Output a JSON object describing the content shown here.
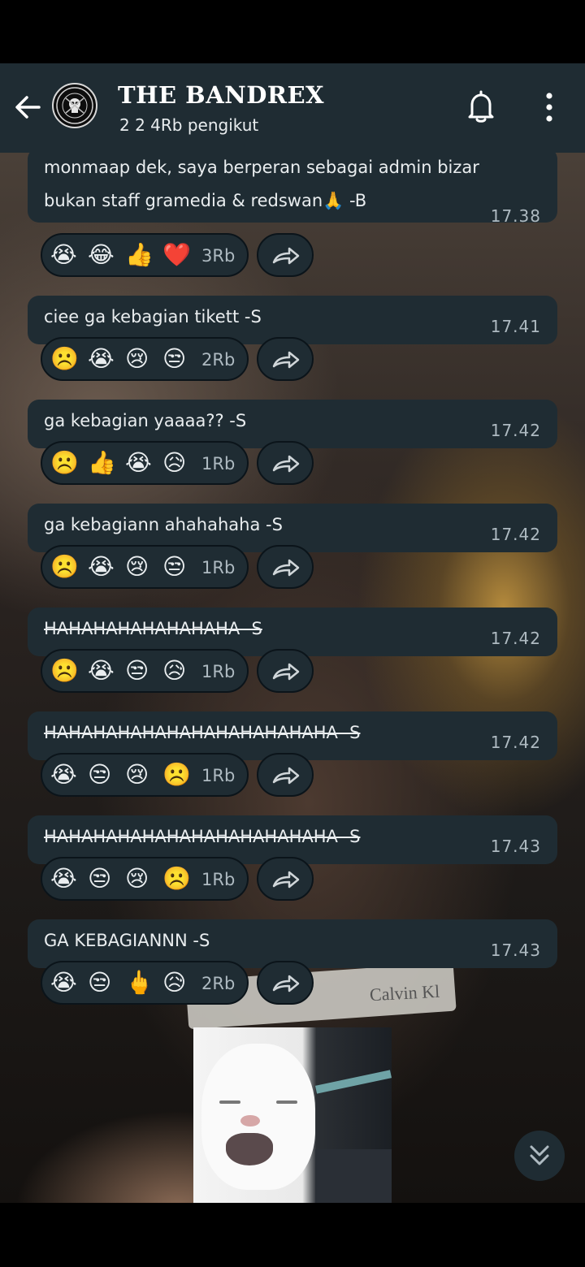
{
  "channel": {
    "title": "THE BANDREX",
    "followers": "2 2 4Rb pengikut"
  },
  "messages": [
    {
      "text": "monmaap dek, saya berperan sebagai admin bizar bukan staff gramedia & redswan🙏  -B",
      "time": "17.38",
      "reactions": [
        "😭",
        "😂",
        "👍",
        "❤️"
      ],
      "count": "3Rb",
      "strike": false
    },
    {
      "text": "ciee ga kebagian tikett -S",
      "time": "17.41",
      "reactions": [
        "☹️",
        "😭",
        "😢",
        "😒"
      ],
      "count": "2Rb",
      "strike": false
    },
    {
      "text": "ga kebagian yaaaa?? -S",
      "time": "17.42",
      "reactions": [
        "☹️",
        "👍",
        "😭",
        "😥"
      ],
      "count": "1Rb",
      "strike": false
    },
    {
      "text": "ga kebagiann ahahahaha -S",
      "time": "17.42",
      "reactions": [
        "☹️",
        "😭",
        "😢",
        "😒"
      ],
      "count": "1Rb",
      "strike": false
    },
    {
      "text": "HAHAHAHAHAHAHAHA -S",
      "time": "17.42",
      "reactions": [
        "☹️",
        "😭",
        "😒",
        "😥"
      ],
      "count": "1Rb",
      "strike": true
    },
    {
      "text": "HAHAHAHAHAHAHAHAHAHAHAHA -S",
      "time": "17.42",
      "reactions": [
        "😭",
        "😒",
        "😢",
        "☹️"
      ],
      "count": "1Rb",
      "strike": true
    },
    {
      "text": "HAHAHAHAHAHAHAHAHAHAHAHA -S",
      "time": "17.43",
      "reactions": [
        "😭",
        "😒",
        "😢",
        "☹️"
      ],
      "count": "1Rb",
      "strike": true
    },
    {
      "text": "GA KEBAGIANNN -S",
      "time": "17.43",
      "reactions": [
        "😭",
        "😒",
        "🖕",
        "😥"
      ],
      "count": "2Rb",
      "strike": false
    }
  ],
  "background": {
    "waistband_text": "Calvin Kl"
  },
  "icons": {
    "back": "arrow-left-icon",
    "bell": "bell-icon",
    "menu": "more-vertical-icon",
    "forward": "forward-arrow-icon",
    "scroll_down": "double-chevron-down-icon"
  },
  "colors": {
    "header_bg": "#1f2c33",
    "bubble_bg": "#1f2c33",
    "text_primary": "#e9edef",
    "text_secondary": "#aebac1"
  }
}
